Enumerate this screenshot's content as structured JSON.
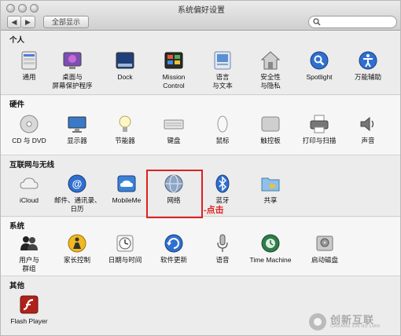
{
  "window": {
    "title": "系统偏好设置",
    "nav": {
      "back": "◀",
      "forward": "▶",
      "show_all": "全部显示"
    },
    "search_placeholder": ""
  },
  "sections": [
    {
      "title": "个人",
      "items": [
        {
          "label": "通用",
          "icon": "general-icon"
        },
        {
          "label": "桌面与",
          "label2": "屏幕保护程序",
          "icon": "desktop-icon"
        },
        {
          "label": "Dock",
          "icon": "dock-icon"
        },
        {
          "label": "Mission",
          "label2": "Control",
          "icon": "mission-control-icon"
        },
        {
          "label": "语言",
          "label2": "与文本",
          "icon": "language-icon"
        },
        {
          "label": "安全性",
          "label2": "与隐私",
          "icon": "security-icon"
        },
        {
          "label": "Spotlight",
          "icon": "spotlight-icon"
        },
        {
          "label": "万能辅助",
          "icon": "accessibility-icon"
        }
      ]
    },
    {
      "title": "硬件",
      "items": [
        {
          "label": "CD 与 DVD",
          "icon": "cd-icon"
        },
        {
          "label": "显示器",
          "icon": "display-icon"
        },
        {
          "label": "节能器",
          "icon": "energy-icon"
        },
        {
          "label": "键盘",
          "icon": "keyboard-icon"
        },
        {
          "label": "鼠标",
          "icon": "mouse-icon"
        },
        {
          "label": "触控板",
          "icon": "trackpad-icon"
        },
        {
          "label": "打印与扫描",
          "icon": "printer-icon"
        },
        {
          "label": "声音",
          "icon": "sound-icon"
        }
      ]
    },
    {
      "title": "互联网与无线",
      "items": [
        {
          "label": "iCloud",
          "icon": "icloud-icon"
        },
        {
          "label": "邮件、通讯录、",
          "label2": "日历",
          "icon": "mail-icon"
        },
        {
          "label": "MobileMe",
          "icon": "mobileme-icon"
        },
        {
          "label": "网络",
          "icon": "network-icon"
        },
        {
          "label": "蓝牙",
          "icon": "bluetooth-icon"
        },
        {
          "label": "共享",
          "icon": "sharing-icon"
        }
      ]
    },
    {
      "title": "系统",
      "items": [
        {
          "label": "用户与",
          "label2": "群组",
          "icon": "users-icon"
        },
        {
          "label": "家长控制",
          "icon": "parental-icon"
        },
        {
          "label": "日期与时间",
          "icon": "datetime-icon"
        },
        {
          "label": "软件更新",
          "icon": "update-icon"
        },
        {
          "label": "语音",
          "icon": "speech-icon"
        },
        {
          "label": "Time Machine",
          "icon": "timemachine-icon"
        },
        {
          "label": "启动磁盘",
          "icon": "startup-disk-icon"
        }
      ]
    },
    {
      "title": "其他",
      "items": [
        {
          "label": "Flash Player",
          "icon": "flash-icon"
        }
      ]
    }
  ],
  "annotation": {
    "text": "-点击"
  },
  "watermark": {
    "brand": "创新互联",
    "sub": "CHUANG XIN HU LIAN"
  }
}
